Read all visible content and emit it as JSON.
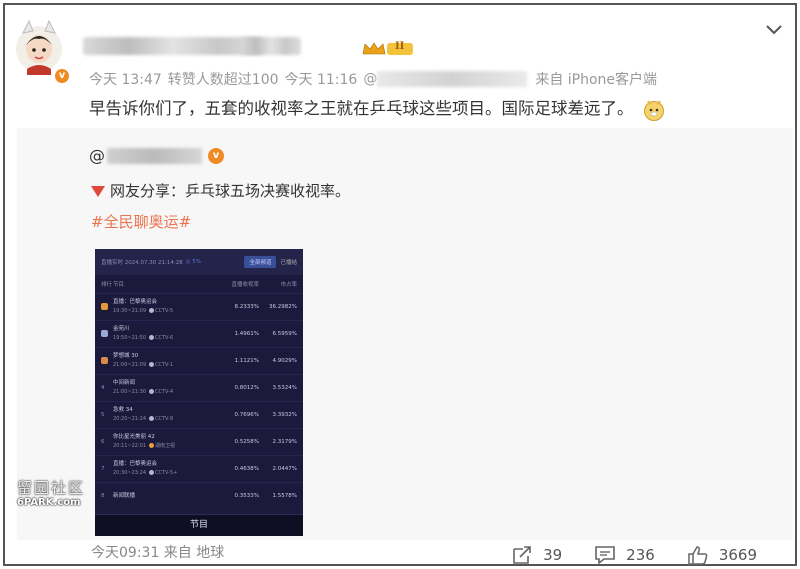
{
  "post": {
    "meta_time": "今天 13:47",
    "meta_repost": "转赞人数超过100",
    "meta_time2": "今天 11:16",
    "meta_at": "@",
    "meta_source": "来自 iPhone客户端",
    "text": "早告诉你们了，五套的收视率之王就在乒乓球这些项目。国际足球差远了。",
    "vip_label": "II"
  },
  "repost": {
    "author_prefix": "@",
    "text": "网友分享：乒乓球五场决赛收视率。",
    "hashtag": "#全民聊奥运#"
  },
  "screenshot": {
    "top_label": "直播实时 2024.07.30 21:14:28",
    "top_live": "◎ 5%",
    "btn1": "全部频道",
    "btn2": "已播结",
    "header": {
      "rank": "排行",
      "program": "节目",
      "rating": "直播收视率",
      "share": "市占率"
    },
    "rows": [
      {
        "rank": "1",
        "program": "直播：巴黎奥运会",
        "time": "19:30~21:09",
        "channel": "CCTV-5",
        "rating": "8.2333%",
        "share": "36.2982%",
        "color": "#e29a3a",
        "alt": false
      },
      {
        "rank": "2",
        "program": "金苑川",
        "time": "19:50~21:50",
        "channel": "CCTV-6",
        "rating": "1.4961%",
        "share": "6.5959%",
        "color": "#9aa8d6",
        "alt": false
      },
      {
        "rank": "3",
        "program": "梦想城 30",
        "time": "21:00~21:09",
        "channel": "CCTV-1",
        "rating": "1.1121%",
        "share": "4.9029%",
        "color": "#d98a48",
        "alt": false
      },
      {
        "rank": "4",
        "program": "中间新闻",
        "time": "21:00~21:30",
        "channel": "CCTV-4",
        "rating": "0.8012%",
        "share": "3.5324%",
        "color": "",
        "alt": false
      },
      {
        "rank": "5",
        "program": "急救 34",
        "time": "20:20~21:24",
        "channel": "CCTV-8",
        "rating": "0.7696%",
        "share": "3.3932%",
        "color": "",
        "alt": false
      },
      {
        "rank": "6",
        "program": "你比星光美丽 42",
        "time": "20:11~22:01",
        "channel": "湖南卫视",
        "rating": "0.5258%",
        "share": "2.3179%",
        "color": "",
        "alt": true
      },
      {
        "rank": "7",
        "program": "直播：巴黎奥运会",
        "time": "20:30~23:24",
        "channel": "CCTV-5+",
        "rating": "0.4638%",
        "share": "2.0447%",
        "color": "",
        "alt": false
      },
      {
        "rank": "8",
        "program": "新闻联播",
        "time": "",
        "channel": "",
        "rating": "0.3533%",
        "share": "1.5578%",
        "color": "",
        "alt": false
      }
    ],
    "footer": "节目"
  },
  "watermark": {
    "line1": "留园社区",
    "line2": "6PARK.com"
  },
  "footer": {
    "time": "今天09:31 来自 地球",
    "reposts": "39",
    "comments": "236",
    "likes": "3669"
  },
  "colors": {
    "link": "#eb7350",
    "badge": "#f08a24",
    "triangle": "#e0473a"
  }
}
